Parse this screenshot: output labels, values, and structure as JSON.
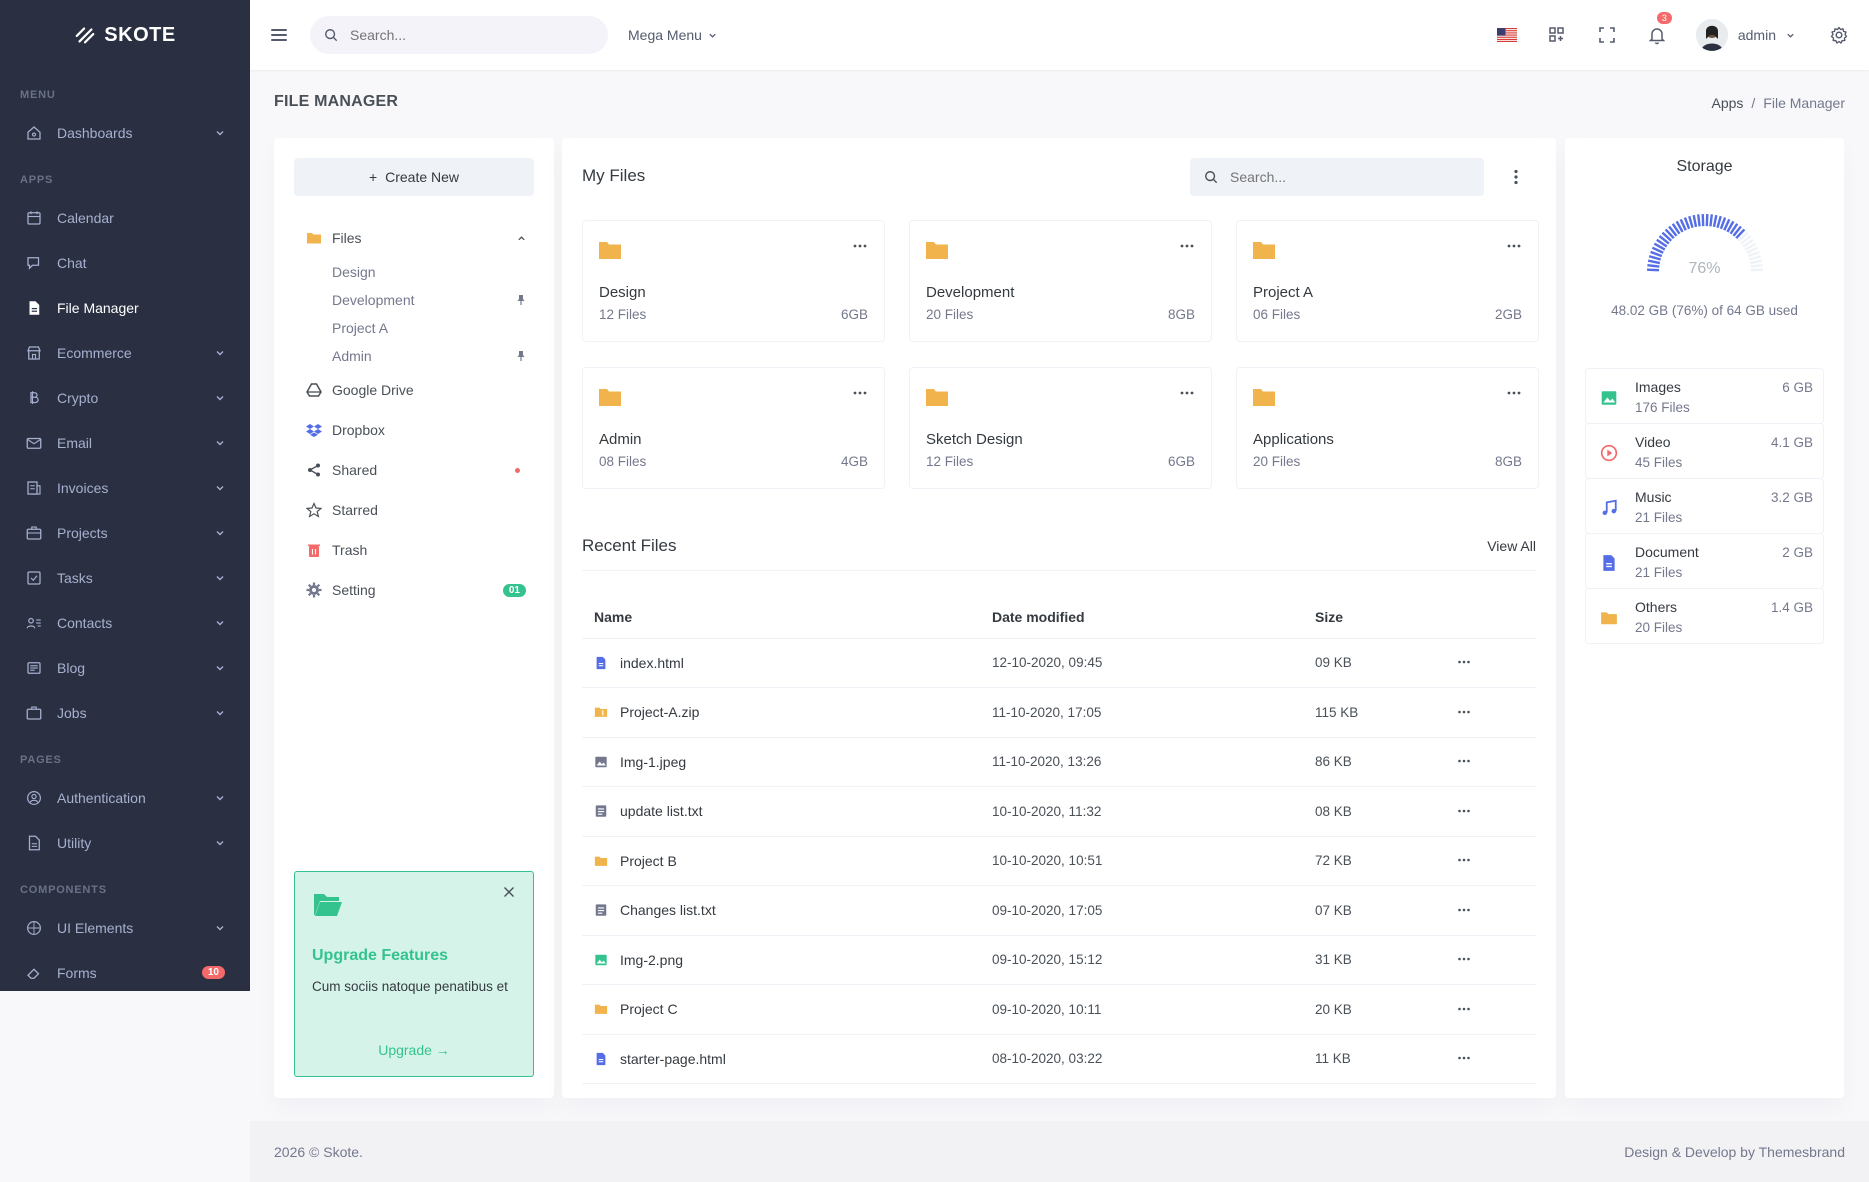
{
  "brand": {
    "name": "SKOTE"
  },
  "sidebar": {
    "sections": {
      "menu": "MENU",
      "apps": "APPS",
      "pages": "PAGES",
      "components": "COMPONENTS"
    },
    "items": {
      "dashboards": "Dashboards",
      "calendar": "Calendar",
      "chat": "Chat",
      "file_manager": "File Manager",
      "ecommerce": "Ecommerce",
      "crypto": "Crypto",
      "email": "Email",
      "invoices": "Invoices",
      "projects": "Projects",
      "tasks": "Tasks",
      "contacts": "Contacts",
      "blog": "Blog",
      "jobs": "Jobs",
      "authentication": "Authentication",
      "utility": "Utility",
      "ui_elements": "UI Elements",
      "forms": "Forms"
    },
    "forms_badge": "10",
    "active": "File Manager"
  },
  "header": {
    "search_placeholder": "Search...",
    "mega_menu": "Mega Menu",
    "notif_count": "3",
    "user": "admin"
  },
  "page": {
    "title": "FILE MANAGER",
    "breadcrumb": [
      "Apps",
      "File Manager"
    ]
  },
  "left": {
    "create_new": "Create New",
    "files": "Files",
    "subfolders": [
      "Design",
      "Development",
      "Project A",
      "Admin"
    ],
    "google_drive": "Google Drive",
    "dropbox": "Dropbox",
    "shared": "Shared",
    "starred": "Starred",
    "trash": "Trash",
    "setting": "Setting",
    "setting_badge": "01",
    "upgrade": {
      "title": "Upgrade Features",
      "text": "Cum sociis natoque penatibus et",
      "link": "Upgrade"
    }
  },
  "mid": {
    "title": "My Files",
    "search_placeholder": "Search...",
    "folders": [
      {
        "name": "Design",
        "files": "12 Files",
        "size": "6GB"
      },
      {
        "name": "Development",
        "files": "20 Files",
        "size": "8GB"
      },
      {
        "name": "Project A",
        "files": "06 Files",
        "size": "2GB"
      },
      {
        "name": "Admin",
        "files": "08 Files",
        "size": "4GB"
      },
      {
        "name": "Sketch Design",
        "files": "12 Files",
        "size": "6GB"
      },
      {
        "name": "Applications",
        "files": "20 Files",
        "size": "8GB"
      }
    ],
    "recent_title": "Recent Files",
    "view_all": "View All",
    "columns": {
      "name": "Name",
      "date": "Date modified",
      "size": "Size"
    },
    "recent": [
      {
        "name": "index.html",
        "date": "12-10-2020, 09:45",
        "size": "09 KB",
        "icon": "doc-icon",
        "color": "#556ee6"
      },
      {
        "name": "Project-A.zip",
        "date": "11-10-2020, 17:05",
        "size": "115 KB",
        "icon": "zip-folder-icon",
        "color": "#f1b44c"
      },
      {
        "name": "Img-1.jpeg",
        "date": "11-10-2020, 13:26",
        "size": "86 KB",
        "icon": "image-icon",
        "color": "#74788d"
      },
      {
        "name": "update list.txt",
        "date": "10-10-2020, 11:32",
        "size": "08 KB",
        "icon": "text-file-icon",
        "color": "#74788d"
      },
      {
        "name": "Project B",
        "date": "10-10-2020, 10:51",
        "size": "72 KB",
        "icon": "folder-icon",
        "color": "#f1b44c"
      },
      {
        "name": "Changes list.txt",
        "date": "09-10-2020, 17:05",
        "size": "07 KB",
        "icon": "text-file-icon",
        "color": "#74788d"
      },
      {
        "name": "Img-2.png",
        "date": "09-10-2020, 15:12",
        "size": "31 KB",
        "icon": "image-icon",
        "color": "#34c38f"
      },
      {
        "name": "Project C",
        "date": "09-10-2020, 10:11",
        "size": "20 KB",
        "icon": "folder-icon",
        "color": "#f1b44c"
      },
      {
        "name": "starter-page.html",
        "date": "08-10-2020, 03:22",
        "size": "11 KB",
        "icon": "doc-icon",
        "color": "#556ee6"
      }
    ]
  },
  "storage": {
    "title": "Storage",
    "percent": 76,
    "percent_label": "76%",
    "used_text": "48.02 GB (76%) of 64 GB used",
    "items": [
      {
        "name": "Images",
        "files": "176 Files",
        "size": "6 GB",
        "icon": "image-icon",
        "color": "#34c38f"
      },
      {
        "name": "Video",
        "files": "45 Files",
        "size": "4.1 GB",
        "icon": "play-icon",
        "color": "#f46a6a"
      },
      {
        "name": "Music",
        "files": "21 Files",
        "size": "3.2 GB",
        "icon": "music-icon",
        "color": "#556ee6"
      },
      {
        "name": "Document",
        "files": "21 Files",
        "size": "2 GB",
        "icon": "document-icon",
        "color": "#556ee6"
      },
      {
        "name": "Others",
        "files": "20 Files",
        "size": "1.4 GB",
        "icon": "folder-icon",
        "color": "#f1b44c"
      }
    ]
  },
  "footer": {
    "left": "2026 © Skote.",
    "right": "Design & Develop by Themesbrand"
  },
  "colors": {
    "sidebar_bg": "#2a3042",
    "accent": "#556ee6",
    "success": "#34c38f",
    "warning": "#f1b44c",
    "danger": "#f46a6a"
  }
}
